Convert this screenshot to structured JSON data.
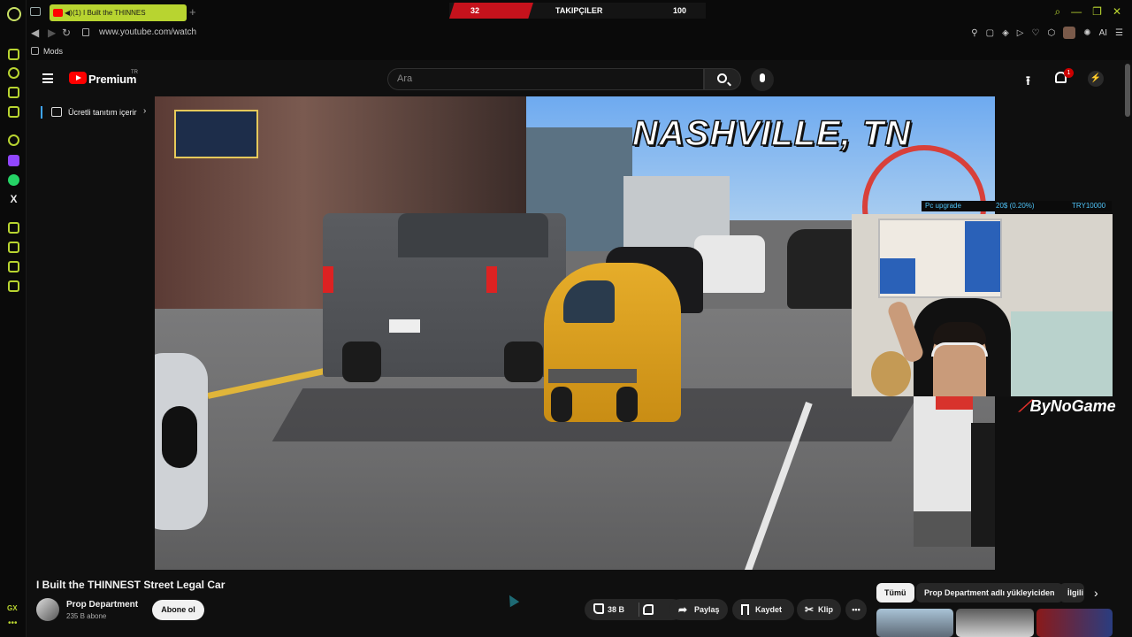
{
  "browser": {
    "tab_title": "(1) I Built the THINNES",
    "new_tab_symbol": "+",
    "url": "www.youtube.com/watch",
    "bookmark_label": "Mods",
    "gx_label": "GX",
    "window_controls": [
      "⌕",
      "—",
      "❐",
      "✕"
    ],
    "extensions_ai_label": "AI"
  },
  "stream_overlay": {
    "left_count": "32",
    "center_label": "TAKIPÇILER",
    "right_count": "100",
    "donation_label": "Pc upgrade",
    "donation_progress": "20$ (0.20%)",
    "donation_goal": "TRY10000",
    "streamer_brand": "ByNoGame"
  },
  "youtube": {
    "brand": "Premium",
    "region": "TR",
    "search_placeholder": "Ara",
    "notification_count": "1",
    "sidebar_promo": "Ücretli tanıtım içerir",
    "video_caption": "NASHVILLE, TN",
    "video_title": "I Built the THINNEST Street Legal Car",
    "channel_name": "Prop Department",
    "subscriber_count": "235 B abone",
    "subscribe_label": "Abone ol",
    "like_count": "38 B",
    "share_label": "Paylaş",
    "save_label": "Kaydet",
    "clip_label": "Klip",
    "more_symbol": "•••",
    "chips": [
      "Tümü",
      "Prop Department adlı yükleyiciden",
      "İlgili"
    ]
  },
  "colors": {
    "accent_gx": "#b8d430",
    "youtube_red": "#ff0000",
    "overlay_red": "#c5121c",
    "donation_blue": "#4fc3f7"
  },
  "icons": [
    "search-icon",
    "mic-icon",
    "upload-icon",
    "bell-icon",
    "like-icon",
    "dislike-icon",
    "share-icon",
    "save-icon",
    "clip-icon",
    "more-icon",
    "menu-icon",
    "lock-icon"
  ]
}
